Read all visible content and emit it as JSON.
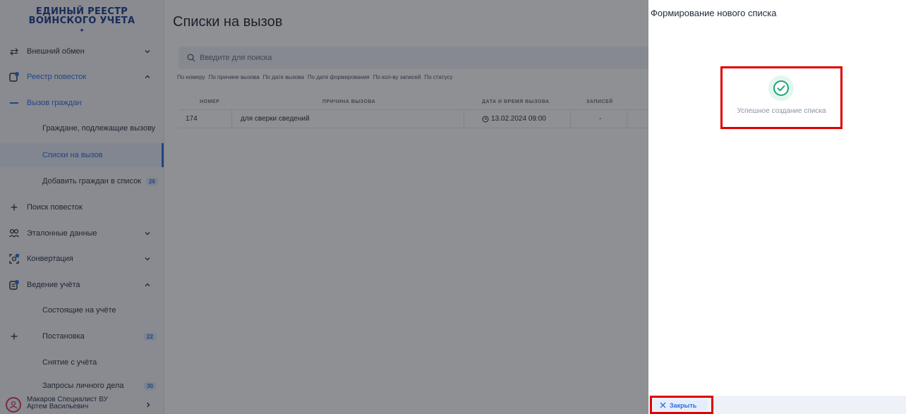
{
  "sidebar": {
    "logo_line1": "ЕДИНЫЙ РЕЕСТР",
    "logo_line2": "ВОИНСКОГО УЧЕТА",
    "items": [
      {
        "label": "Внешний обмен"
      },
      {
        "label": "Реестр повесток"
      },
      {
        "label": "Вызов граждан"
      },
      {
        "label": "Граждане, подлежащие вызову"
      },
      {
        "label": "Списки на вызов"
      },
      {
        "label": "Добавить граждан в список",
        "badge": "26"
      },
      {
        "label": "Поиск повесток"
      },
      {
        "label": "Эталонные данные"
      },
      {
        "label": "Конвертация"
      },
      {
        "label": "Ведение учёта"
      },
      {
        "label": "Состоящие на учёте"
      },
      {
        "label": "Постановка",
        "badge": "22"
      },
      {
        "label": "Снятие с учёта"
      },
      {
        "label": "Запросы личного дела",
        "badge": "30"
      }
    ],
    "user": {
      "line1": "Макаров Специалист ВУ",
      "line2": "Артем Васильевич"
    }
  },
  "main": {
    "title": "Списки на вызов",
    "search_placeholder": "Введите для поиска",
    "sort_options": [
      "По номеру",
      "По причине вызова",
      "По дате вызова",
      "По дате формирования",
      "По кол-ву записей",
      "По статусу"
    ],
    "table": {
      "headers": [
        "НОМЕР",
        "ПРИЧИНА ВЫЗОВА",
        "ДАТА И ВРЕМЯ ВЫЗОВА",
        "ЗАПИСЕЙ"
      ],
      "rows": [
        {
          "number": "174",
          "reason": "для сверки сведений",
          "datetime": "13.02.2024 09:00",
          "records": "-"
        }
      ]
    }
  },
  "panel": {
    "title": "Формирование нового списка",
    "success_text": "Успешное создание списка",
    "close_label": "Закрыть"
  },
  "colors": {
    "accent": "#2f6fdb",
    "success": "#1fa37a",
    "highlight": "#e00000"
  }
}
